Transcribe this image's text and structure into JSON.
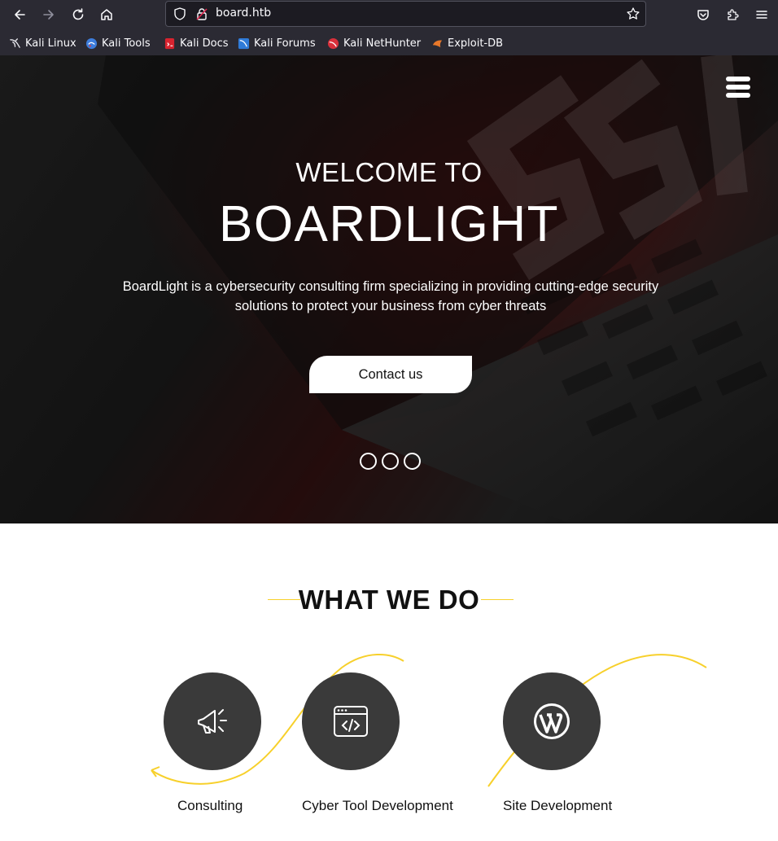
{
  "browser": {
    "url": "board.htb",
    "bookmarks": [
      {
        "label": "Kali Linux",
        "icon": "kali-dragon-icon"
      },
      {
        "label": "Kali Tools",
        "icon": "kali-tools-icon"
      },
      {
        "label": "Kali Docs",
        "icon": "kali-docs-icon"
      },
      {
        "label": "Kali Forums",
        "icon": "kali-forums-icon"
      },
      {
        "label": "Kali NetHunter",
        "icon": "kali-nethunter-icon"
      },
      {
        "label": "Exploit-DB",
        "icon": "exploit-db-icon"
      }
    ],
    "icons": [
      "back-arrow-icon",
      "forward-arrow-icon",
      "reload-icon",
      "home-icon",
      "shield-icon",
      "lock-icon",
      "bookmark-star-icon",
      "pocket-icon",
      "extensions-icon",
      "hamburger-menu-icon"
    ]
  },
  "hero": {
    "subtitle": "WELCOME TO",
    "title": "BOARDLIGHT",
    "description": "BoardLight is a cybersecurity consulting firm specializing in providing cutting-edge security solutions to protect your business from cyber threats",
    "cta_label": "Contact us",
    "slide_count": 3,
    "menu_icon": "menu-bars-icon"
  },
  "services": {
    "heading": "WHAT WE DO",
    "accent_color": "#f7d02b",
    "items": [
      {
        "label": "Consulting",
        "icon": "megaphone-icon"
      },
      {
        "label": "Cyber Tool Development",
        "icon": "code-window-icon"
      },
      {
        "label": "Site Development",
        "icon": "wordpress-icon"
      }
    ]
  }
}
